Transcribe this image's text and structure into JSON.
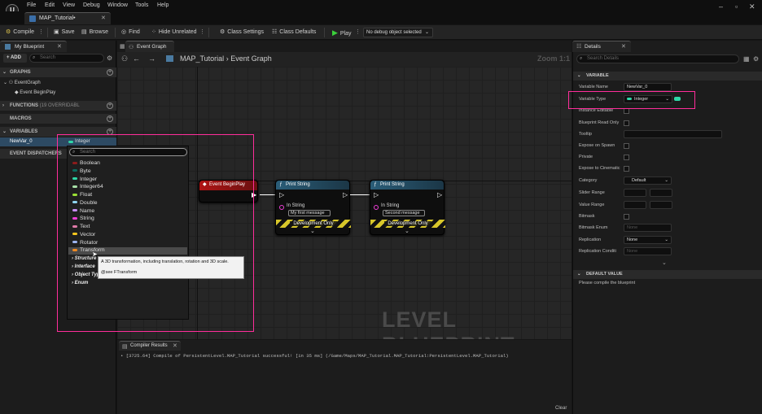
{
  "menubar": {
    "logo": "U",
    "items": [
      "File",
      "Edit",
      "View",
      "Debug",
      "Window",
      "Tools",
      "Help"
    ],
    "window_controls": [
      "–",
      "▫",
      "✕"
    ]
  },
  "document_tab": {
    "label": "MAP_Tutorial•",
    "close": "✕"
  },
  "toolbar": {
    "compile": "Compile",
    "save": "Save",
    "browse": "Browse",
    "find": "Find",
    "hide_unrelated": "Hide Unrelated",
    "class_settings": "Class Settings",
    "class_defaults": "Class Defaults",
    "play": "Play",
    "debug_dropdown": "No debug object selected",
    "more": "⋮"
  },
  "my_blueprint": {
    "tab_label": "My Blueprint",
    "close": "✕",
    "add_label": "+ ADD",
    "search_placeholder": "Search",
    "graphs_label": "GRAPHS",
    "event_graph": "EventGraph",
    "event_begin_play": "Event BeginPlay",
    "functions_label": "FUNCTIONS",
    "functions_count": "(19 OVERRIDABL",
    "macros_label": "MACROS",
    "variables_label": "VARIABLES",
    "var_name": "NewVar_0",
    "var_type": "Integer",
    "event_dispatchers_label": "EVENT DISPATCHERS"
  },
  "type_popup": {
    "search_placeholder": "Search",
    "types": [
      {
        "label": "Boolean",
        "color": "#8c1c1c"
      },
      {
        "label": "Byte",
        "color": "#0b6b5e"
      },
      {
        "label": "Integer",
        "color": "#2fd8a8"
      },
      {
        "label": "Integer64",
        "color": "#a8e0a8"
      },
      {
        "label": "Float",
        "color": "#9be035"
      },
      {
        "label": "Double",
        "color": "#8fd4f0"
      },
      {
        "label": "Name",
        "color": "#c58df0"
      },
      {
        "label": "String",
        "color": "#ef3ed7"
      },
      {
        "label": "Text",
        "color": "#e07aa8"
      },
      {
        "label": "Vector",
        "color": "#f7c71e"
      },
      {
        "label": "Rotator",
        "color": "#9cb4f0"
      },
      {
        "label": "Transform",
        "color": "#f08a22"
      }
    ],
    "categories": [
      "Structure",
      "Interface",
      "Object Types",
      "Enum"
    ],
    "tooltip_line1": "A 3D transformation, including translation, rotation and 3D scale.",
    "tooltip_line2": "@see FTransform"
  },
  "graph": {
    "tab_label": "Event Graph",
    "breadcrumb_root": "MAP_Tutorial",
    "breadcrumb_sep": "›",
    "breadcrumb_leaf": "Event Graph",
    "zoom": "Zoom 1:1",
    "watermark": "LEVEL BLUEPRINT",
    "event_node_title": "Event BeginPlay",
    "print_node_title": "Print String",
    "in_string_label": "In String",
    "print1_value": "My first message",
    "print2_value": "Second message",
    "dev_only": "Development Only"
  },
  "compiler": {
    "tab_label": "Compiler Results",
    "close": "✕",
    "message": "• [3725.64] Compile of PersistentLevel.MAP_Tutorial successful! [in 35 ms] (/Game/Maps/MAP_Tutorial.MAP_Tutorial:PersistentLevel.MAP_Tutorial)",
    "clear": "Clear"
  },
  "details": {
    "tab_label": "Details",
    "close": "✕",
    "search_placeholder": "Search Details",
    "variable_section": "VARIABLE",
    "variable_name_label": "Variable Name",
    "variable_name_value": "NewVar_0",
    "variable_type_label": "Variable Type",
    "variable_type_value": "Integer",
    "instance_editable": "Instance Editable",
    "blueprint_read_only": "Blueprint Read Only",
    "tooltip_label": "Tooltip",
    "expose_spawn": "Expose on Spawn",
    "private_label": "Private",
    "expose_cinematics": "Expose to Cinematic",
    "category_label": "Category",
    "category_value": "Default",
    "slider_range": "Slider Range",
    "value_range": "Value Range",
    "bitmask": "Bitmask",
    "bitmask_enum": "Bitmask Enum",
    "bitmask_enum_value": "None",
    "replication": "Replication",
    "replication_value": "None",
    "replication_condition": "Replication Conditi",
    "replication_condition_value": "None",
    "default_value_section": "DEFAULT VALUE",
    "compile_note": "Please compile the blueprint"
  }
}
